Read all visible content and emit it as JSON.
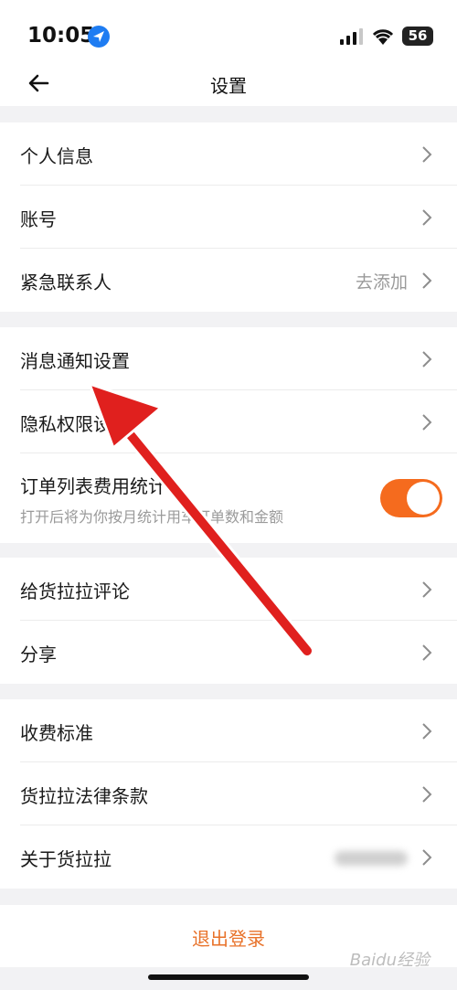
{
  "status_bar": {
    "time": "10:05",
    "battery": "56"
  },
  "header": {
    "title": "设置"
  },
  "groups": [
    {
      "items": [
        {
          "label": "个人信息"
        },
        {
          "label": "账号"
        },
        {
          "label": "紧急联系人",
          "value": "去添加"
        }
      ]
    },
    {
      "items": [
        {
          "label": "消息通知设置"
        },
        {
          "label": "隐私权限设置"
        },
        {
          "label": "订单列表费用统计",
          "sublabel": "打开后将为你按月统计用车订单数和金额",
          "toggle_on": true
        }
      ]
    },
    {
      "items": [
        {
          "label": "给货拉拉评论"
        },
        {
          "label": "分享"
        }
      ]
    },
    {
      "items": [
        {
          "label": "收费标准"
        },
        {
          "label": "货拉拉法律条款"
        },
        {
          "label": "关于货拉拉"
        }
      ]
    }
  ],
  "logout": {
    "label": "退出登录"
  },
  "watermark": "Baidu经验",
  "colors": {
    "accent": "#f56b1e",
    "logout_text": "#e8722a",
    "annotation_arrow": "#e0201e"
  }
}
